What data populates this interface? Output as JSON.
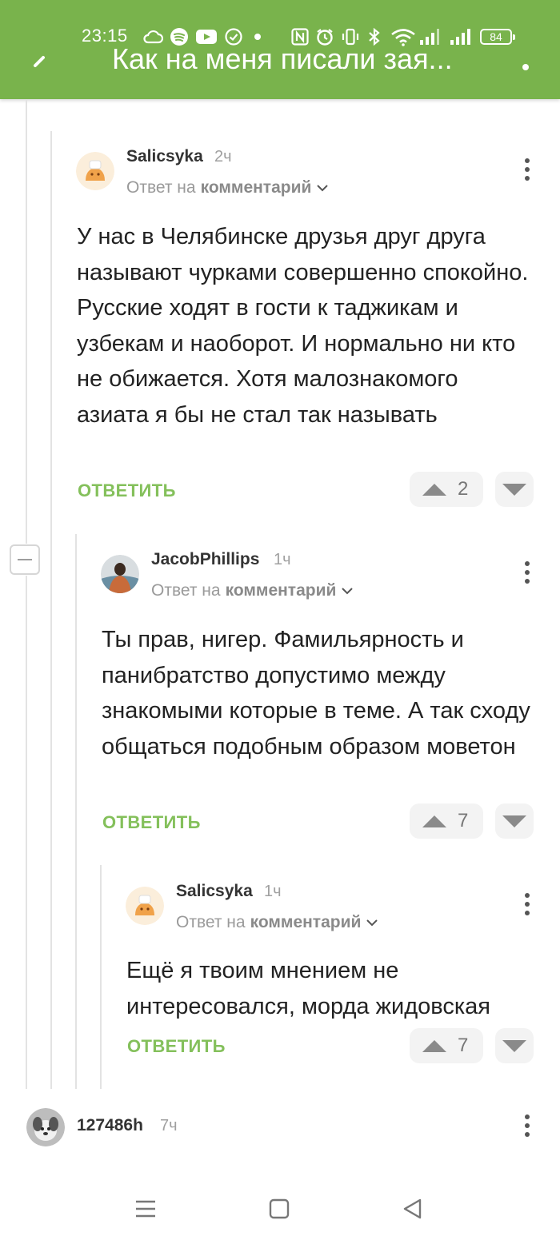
{
  "status_bar": {
    "time": "23:15",
    "battery": "84"
  },
  "header": {
    "title": "Как на меня писали зая..."
  },
  "comments": [
    {
      "author": "Salicsyka",
      "time": "2ч",
      "reply_prefix": "Ответ на",
      "reply_target": "комментарий",
      "text": "У нас в Челябинске друзья друг друга называют чурками совершенно спокойно. Русские ходят в гости к таджикам и узбекам и наоборот. И нормально ни кто не обижается. Хотя малознакомого азиата я бы не стал так называть",
      "reply_label": "ОТВЕТИТЬ",
      "rating": "2"
    },
    {
      "author": "JacobPhillips",
      "time": "1ч",
      "reply_prefix": "Ответ на",
      "reply_target": "комментарий",
      "text": "Ты прав, нигер. Фамильярность и панибратство допустимо между знакомыми которые в теме. А так сходу общаться подобным образом моветон",
      "reply_label": "ОТВЕТИТЬ",
      "rating": "7"
    },
    {
      "author": "Salicsyka",
      "time": "1ч",
      "reply_prefix": "Ответ на",
      "reply_target": "комментарий",
      "text": "Ещё я твоим мнением не интересовался, морда жидовская",
      "reply_label": "ОТВЕТИТЬ",
      "rating": "7"
    },
    {
      "author": "127486h",
      "time": "7ч"
    }
  ],
  "icons": {
    "back": "arrow-back-icon",
    "more": "more-vertical-icon",
    "collapse": "minus-icon",
    "upvote": "triangle-up-icon",
    "downvote": "triangle-down-icon",
    "nav_menu": "menu-icon",
    "nav_home": "square-icon",
    "nav_back": "triangle-left-icon"
  },
  "colors": {
    "brand": "#79b34c",
    "reply_link": "#84c05b"
  }
}
